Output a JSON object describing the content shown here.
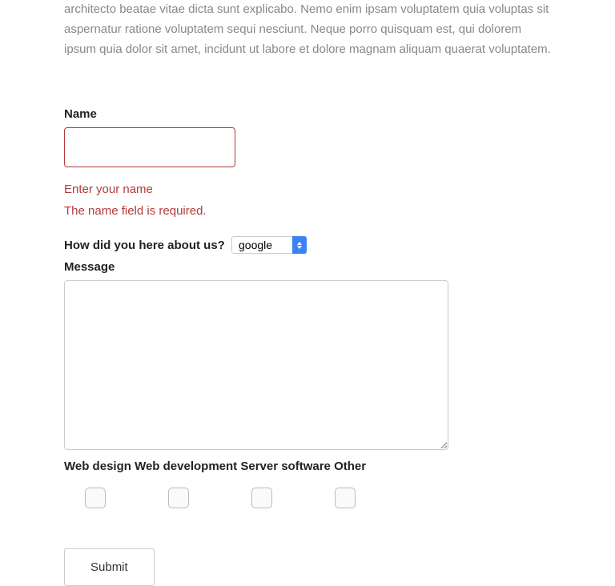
{
  "intro": "architecto beatae vitae dicta sunt explicabo. Nemo enim ipsam voluptatem quia voluptas sit aspernatur ratione voluptatem sequi nesciunt. Neque porro quisquam est, qui dolorem ipsum quia dolor sit amet, incidunt ut labore et dolore magnam aliquam quaerat voluptatem.",
  "form": {
    "name": {
      "label": "Name",
      "value": "",
      "error1": "Enter your name",
      "error2": "The name field is required."
    },
    "source": {
      "label": "How did you here about us?",
      "selected": "google"
    },
    "message": {
      "label": "Message",
      "value": ""
    },
    "checkboxes": {
      "label1": "Web design",
      "label2": "Web development",
      "label3": "Server software",
      "label4": "Other"
    },
    "submit": "Submit"
  }
}
